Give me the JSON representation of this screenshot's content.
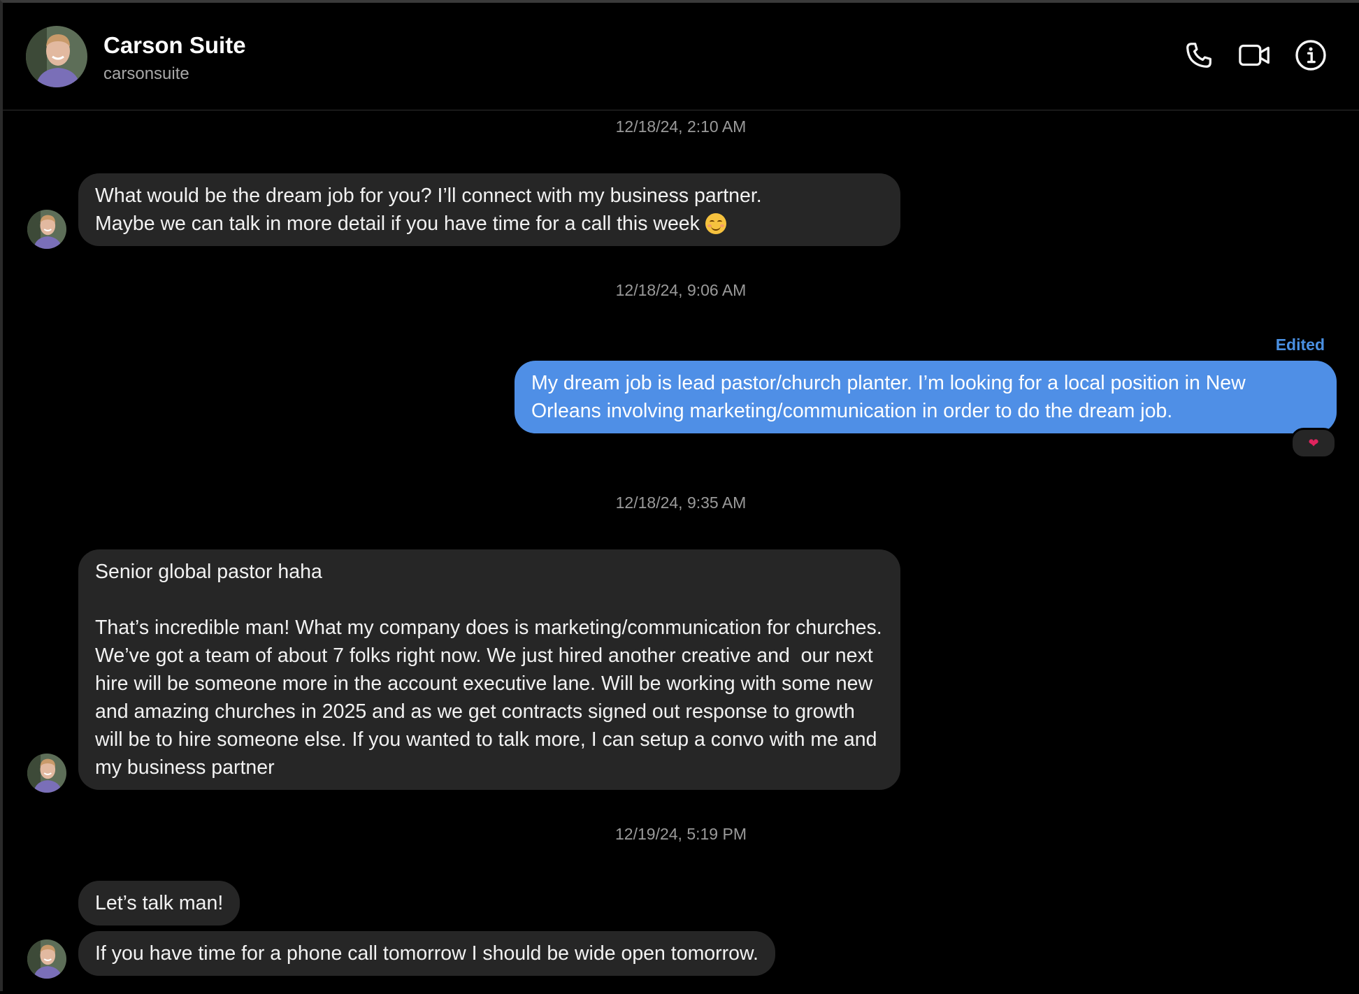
{
  "header": {
    "name": "Carson Suite",
    "username": "carsonsuite",
    "avatar_icon": "person-avatar-icon",
    "actions": [
      {
        "id": "call",
        "icon": "phone-icon"
      },
      {
        "id": "video",
        "icon": "video-camera-icon"
      },
      {
        "id": "info",
        "icon": "info-icon"
      }
    ]
  },
  "colors": {
    "background": "#000000",
    "incoming_bubble": "#262626",
    "outgoing_bubble": "#4f8fe6",
    "edited_label": "#4a90e2",
    "timestamp": "#9a9a9a"
  },
  "thread": {
    "timestamps": [
      "12/18/24, 2:10 AM",
      "12/18/24, 9:06 AM",
      "12/18/24, 9:35 AM",
      "12/19/24, 5:19 PM"
    ],
    "messages": [
      {
        "direction": "incoming",
        "text": "What would be the dream job for you? I’ll connect with my business partner.\nMaybe we can talk in more detail if you have time for a call this week ",
        "emoji": "smiling-face-emoji"
      },
      {
        "direction": "outgoing",
        "edited_label": "Edited",
        "text": "My dream job is lead pastor/church planter. I’m looking for a local position in New Orleans involving marketing/communication in order to do the dream job.",
        "reaction": "❤"
      },
      {
        "direction": "incoming",
        "text": "Senior global pastor haha\n\nThat’s incredible man! What my company does is marketing/communication for churches. We’ve got a team of about 7 folks right now. We just hired another creative and  our next hire will be someone more in the account executive lane. Will be working with some new and amazing churches in 2025 and as we get contracts signed out response to growth will be to hire someone else. If you wanted to talk more, I can setup a convo with me and my business partner"
      },
      {
        "direction": "incoming",
        "text": "Let’s talk man!"
      },
      {
        "direction": "incoming",
        "text": "If you have time for a phone call tomorrow I should be wide open tomorrow."
      }
    ]
  }
}
